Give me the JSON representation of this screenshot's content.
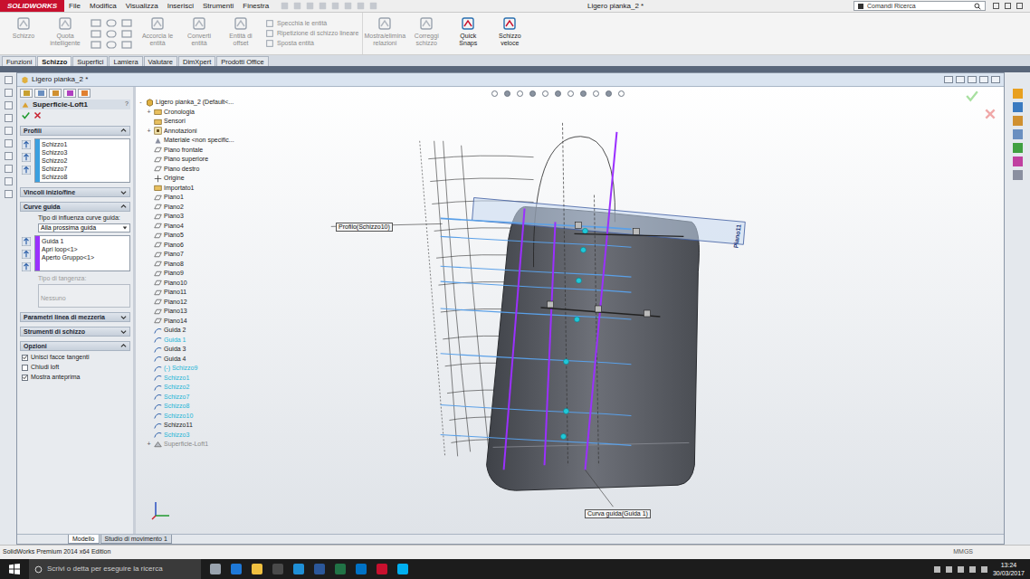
{
  "app": {
    "logo": "SOLIDWORKS"
  },
  "menu": [
    "File",
    "Modifica",
    "Visualizza",
    "Inserisci",
    "Strumenti",
    "Finestra"
  ],
  "title": "Ligero pianka_2 *",
  "search": {
    "placeholder": "Comandi Ricerca"
  },
  "ribbon": [
    {
      "label": "Schizzo",
      "kind": "large",
      "disabled": true
    },
    {
      "label": "Quota intelligente",
      "kind": "large",
      "disabled": true
    },
    {
      "label": "",
      "kind": "tools",
      "disabled": true
    },
    {
      "label": "Accorcia le entità",
      "kind": "large",
      "disabled": true
    },
    {
      "label": "Converti entità",
      "kind": "large",
      "disabled": true
    },
    {
      "label": "Entità di offset",
      "kind": "large",
      "disabled": true
    },
    {
      "label": "Specchia le entità",
      "kind": "small",
      "disabled": true
    },
    {
      "label": "Ripetizione di schizzo lineare",
      "kind": "small",
      "disabled": true
    },
    {
      "label": "Sposta entità",
      "kind": "small",
      "disabled": true
    },
    {
      "label": "Mostra/elimina relazioni",
      "kind": "large",
      "disabled": true
    },
    {
      "label": "Correggi schizzo",
      "kind": "large",
      "disabled": true
    },
    {
      "label": "Quick Snaps",
      "kind": "large",
      "disabled": false
    },
    {
      "label": "Schizzo veloce",
      "kind": "large",
      "disabled": false
    }
  ],
  "command_tabs": [
    {
      "label": "Funzioni",
      "selected": false
    },
    {
      "label": "Schizzo",
      "selected": true
    },
    {
      "label": "Superfici",
      "selected": false
    },
    {
      "label": "Lamiera",
      "selected": false
    },
    {
      "label": "Valutare",
      "selected": false
    },
    {
      "label": "DimXpert",
      "selected": false
    },
    {
      "label": "Prodotti Office",
      "selected": false
    }
  ],
  "document": {
    "title": "Ligero pianka_2 *"
  },
  "property_manager": {
    "title": "Superficie-Loft1",
    "help": "?",
    "profiles": {
      "title": "Profili",
      "expanded": true,
      "items": [
        "Schizzo1",
        "Schizzo3",
        "Schizzo2",
        "Schizzo7",
        "Schizzo8"
      ]
    },
    "end_constraints": {
      "title": "Vincoli inizio/fine",
      "expanded": false
    },
    "guides": {
      "title": "Curve guida",
      "expanded": true,
      "influence_label": "Tipo di influenza curve guida:",
      "influence_value": "Alla prossima guida",
      "items": [
        "Guida 1",
        "Apri loop<1>",
        "Aperto Gruppo<1>"
      ],
      "tangency_label": "Tipo di tangenza:",
      "tangency_value": "Nessuno",
      "tangency_disabled": true
    },
    "centerline": {
      "title": "Parametri linea di mezzeria",
      "expanded": false
    },
    "sketch_tools": {
      "title": "Strumenti di schizzo",
      "expanded": false
    },
    "options": {
      "title": "Opzioni",
      "expanded": true,
      "items": [
        {
          "label": "Unisci facce tangenti",
          "checked": true
        },
        {
          "label": "Chiudi loft",
          "checked": false
        },
        {
          "label": "Mostra anteprima",
          "checked": true
        }
      ]
    }
  },
  "feature_tree": [
    {
      "label": "Ligero pianka_2  (Default<...",
      "kind": "part",
      "expander": "-",
      "highlighted": false,
      "disabled": false
    },
    {
      "label": "Cronologia",
      "kind": "folder",
      "expander": "+",
      "highlighted": false,
      "disabled": false
    },
    {
      "label": "Sensori",
      "kind": "folder",
      "expander": "",
      "highlighted": false,
      "disabled": false
    },
    {
      "label": "Annotazioni",
      "kind": "annotation",
      "expander": "+",
      "highlighted": false,
      "disabled": false
    },
    {
      "label": "Materiale <non specific...",
      "kind": "material",
      "expander": "",
      "highlighted": false,
      "disabled": false
    },
    {
      "label": "Piano frontale",
      "kind": "plane",
      "expander": "",
      "highlighted": false,
      "disabled": false
    },
    {
      "label": "Piano superiore",
      "kind": "plane",
      "expander": "",
      "highlighted": false,
      "disabled": false
    },
    {
      "label": "Piano destro",
      "kind": "plane",
      "expander": "",
      "highlighted": false,
      "disabled": false
    },
    {
      "label": "Origine",
      "kind": "origin",
      "expander": "",
      "highlighted": false,
      "disabled": false
    },
    {
      "label": "Importato1",
      "kind": "folder",
      "expander": "",
      "highlighted": false,
      "disabled": false
    },
    {
      "label": "Piano1",
      "kind": "plane",
      "expander": "",
      "highlighted": false,
      "disabled": false
    },
    {
      "label": "Piano2",
      "kind": "plane",
      "expander": "",
      "highlighted": false,
      "disabled": false
    },
    {
      "label": "Piano3",
      "kind": "plane",
      "expander": "",
      "highlighted": false,
      "disabled": false
    },
    {
      "label": "Piano4",
      "kind": "plane",
      "expander": "",
      "highlighted": false,
      "disabled": false
    },
    {
      "label": "Piano5",
      "kind": "plane",
      "expander": "",
      "highlighted": false,
      "disabled": false
    },
    {
      "label": "Piano6",
      "kind": "plane",
      "expander": "",
      "highlighted": false,
      "disabled": false
    },
    {
      "label": "Piano7",
      "kind": "plane",
      "expander": "",
      "highlighted": false,
      "disabled": false
    },
    {
      "label": "Piano8",
      "kind": "plane",
      "expander": "",
      "highlighted": false,
      "disabled": false
    },
    {
      "label": "Piano9",
      "kind": "plane",
      "expander": "",
      "highlighted": false,
      "disabled": false
    },
    {
      "label": "Piano10",
      "kind": "plane",
      "expander": "",
      "highlighted": false,
      "disabled": false
    },
    {
      "label": "Piano11",
      "kind": "plane",
      "expander": "",
      "highlighted": false,
      "disabled": false
    },
    {
      "label": "Piano12",
      "kind": "plane",
      "expander": "",
      "highlighted": false,
      "disabled": false
    },
    {
      "label": "Piano13",
      "kind": "plane",
      "expander": "",
      "highlighted": false,
      "disabled": false
    },
    {
      "label": "Piano14",
      "kind": "plane",
      "expander": "",
      "highlighted": false,
      "disabled": false
    },
    {
      "label": "Guida 2",
      "kind": "sketch",
      "expander": "",
      "highlighted": false,
      "disabled": false
    },
    {
      "label": "Guida 1",
      "kind": "sketch",
      "expander": "",
      "highlighted": true,
      "disabled": false
    },
    {
      "label": "Guida 3",
      "kind": "sketch",
      "expander": "",
      "highlighted": false,
      "disabled": false
    },
    {
      "label": "Guida 4",
      "kind": "sketch",
      "expander": "",
      "highlighted": false,
      "disabled": false
    },
    {
      "label": "(-) Schizzo9",
      "kind": "sketch",
      "expander": "",
      "highlighted": true,
      "disabled": false
    },
    {
      "label": "Schizzo1",
      "kind": "sketch",
      "expander": "",
      "highlighted": true,
      "disabled": false
    },
    {
      "label": "Schizzo2",
      "kind": "sketch",
      "expander": "",
      "highlighted": true,
      "disabled": false
    },
    {
      "label": "Schizzo7",
      "kind": "sketch",
      "expander": "",
      "highlighted": true,
      "disabled": false
    },
    {
      "label": "Schizzo8",
      "kind": "sketch",
      "expander": "",
      "highlighted": true,
      "disabled": false
    },
    {
      "label": "Schizzo10",
      "kind": "sketch",
      "expander": "",
      "highlighted": true,
      "disabled": false
    },
    {
      "label": "Schizzo11",
      "kind": "sketch",
      "expander": "",
      "highlighted": false,
      "disabled": false
    },
    {
      "label": "Schizzo3",
      "kind": "sketch",
      "expander": "",
      "highlighted": true,
      "disabled": false
    },
    {
      "label": "Superficie-Loft1",
      "kind": "feature",
      "expander": "+",
      "highlighted": false,
      "disabled": true
    }
  ],
  "graphics": {
    "callouts": [
      {
        "text": "Profilo(Schizzo10)"
      },
      {
        "text": "Curva guida(Guida 1)"
      }
    ],
    "plane_label": "Piano11"
  },
  "bottom_tabs": [
    {
      "label": "Modello",
      "selected": true
    },
    {
      "label": "Studio di movimento 1",
      "selected": false
    }
  ],
  "status_bar": {
    "edition": "SolidWorks Premium 2014 x64 Edition",
    "units": "MMGS"
  },
  "taskbar": {
    "search_placeholder": "Scrivi o detta per eseguire la ricerca",
    "time": "13:24",
    "date": "30/03/2017"
  }
}
